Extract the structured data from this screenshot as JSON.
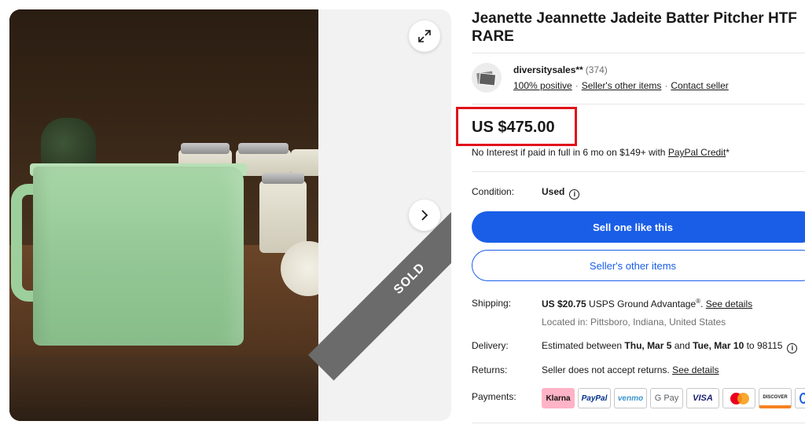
{
  "listing": {
    "title": "Jeanette Jeannette Jadeite Batter Pitcher HTF RARE",
    "sold_label": "SOLD"
  },
  "seller": {
    "name": "diversitysales**",
    "feedback_count": "(374)",
    "positive": "100% positive",
    "other_items": "Seller's other items",
    "contact": "Contact seller",
    "separator": "·"
  },
  "price": {
    "amount": "US $475.00",
    "financing_text": "No Interest if paid in full in 6 mo on $149+ with ",
    "financing_link": "PayPal Credit",
    "financing_suffix": "*"
  },
  "condition": {
    "label": "Condition:",
    "value": "Used",
    "info_glyph": "i"
  },
  "actions": {
    "primary": "Sell one like this",
    "secondary": "Seller's other items"
  },
  "shipping": {
    "label": "Shipping:",
    "cost": "US $20.75",
    "service": " USPS Ground Advantage",
    "reg_mark": "®",
    "period": ". ",
    "details_link": "See details",
    "location": "Located in: Pittsboro, Indiana, United States"
  },
  "delivery": {
    "label": "Delivery:",
    "prefix": "Estimated between ",
    "start": "Thu, Mar 5",
    "and": " and ",
    "end": "Tue, Mar 10",
    "suffix": " to 98115",
    "info_glyph": "i"
  },
  "returns": {
    "label": "Returns:",
    "text": "Seller does not accept returns. ",
    "details_link": "See details"
  },
  "payments": {
    "label": "Payments:",
    "methods": [
      {
        "label": "Klarna",
        "bg": "#ffb3c7",
        "fg": "#17120f"
      },
      {
        "label": "PayPal",
        "bg": "#ffffff",
        "fg": "#003087"
      },
      {
        "label": "venmo",
        "bg": "#ffffff",
        "fg": "#3d95ce"
      },
      {
        "label": "G Pay",
        "bg": "#ffffff",
        "fg": "#5f6368"
      },
      {
        "label": "VISA",
        "bg": "#ffffff",
        "fg": "#1a1f71"
      },
      {
        "label": "",
        "bg": "#ffffff",
        "fg": "#eb001b"
      },
      {
        "label": "DISCOVER",
        "bg": "#ffffff",
        "fg": "#231f20"
      }
    ]
  },
  "colors": {
    "accent": "#1a5ee8",
    "highlight_box": "#e0131a",
    "sold_ribbon": "#6b6b6b"
  },
  "icons": {
    "expand": "expand-icon",
    "next": "chevron-right-icon",
    "info": "info-icon"
  }
}
